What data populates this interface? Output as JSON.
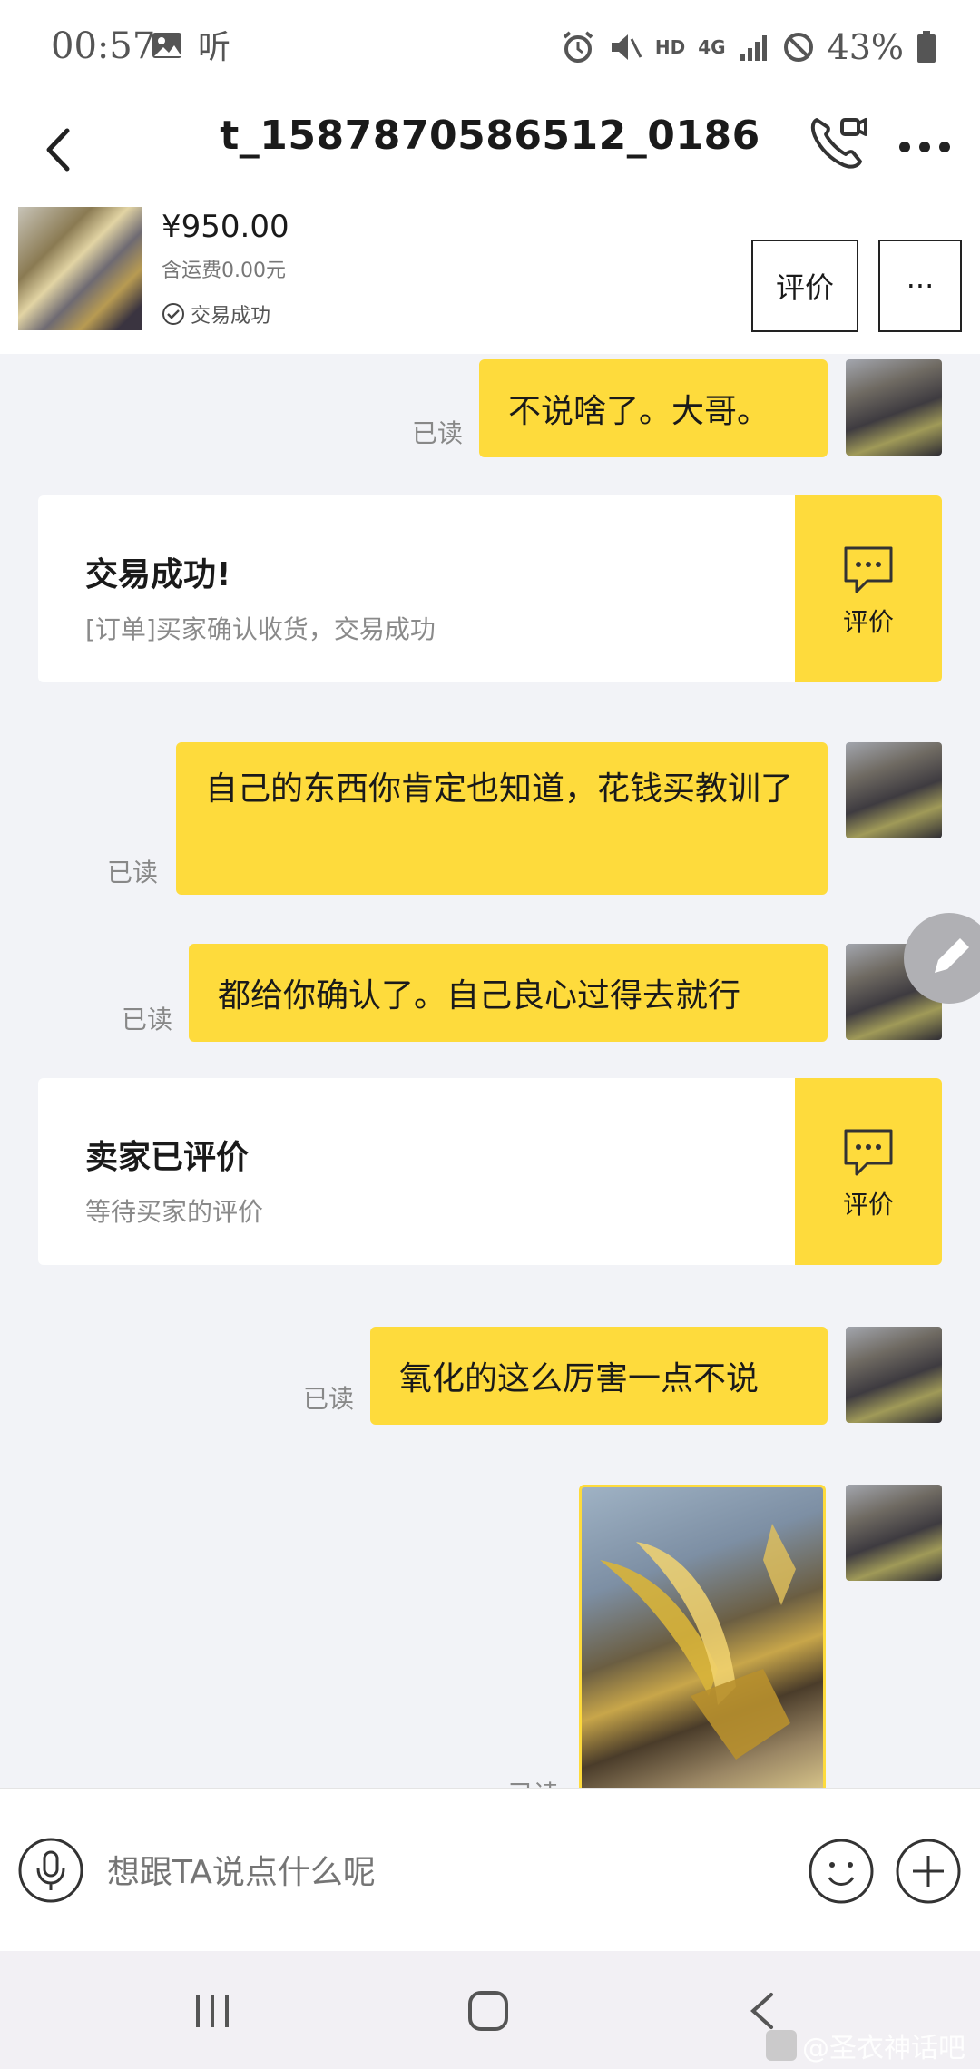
{
  "status_bar": {
    "time": "00:57",
    "hd_label": "HD",
    "network_label": "4G",
    "battery": "43%"
  },
  "header": {
    "title": "t_1587870586512_0186"
  },
  "product": {
    "price": "¥950.00",
    "shipping": "含运费0.00元",
    "status": "交易成功",
    "rate_button": "评价",
    "more_button": "···"
  },
  "messages": [
    {
      "text": "不说啥了。大哥。",
      "read": "已读"
    },
    {
      "text": "自己的东西你肯定也知道，花钱买教训了",
      "read": "已读"
    },
    {
      "text": "都给你确认了。自己良心过得去就行",
      "read": "已读"
    },
    {
      "text": "氧化的这么厉害一点不说",
      "read": "已读"
    },
    {
      "text": "",
      "read": "已读"
    }
  ],
  "cards": [
    {
      "title": "交易成功!",
      "subtitle": "[订单]买家确认收货，交易成功",
      "action": "评价"
    },
    {
      "title": "卖家已评价",
      "subtitle": "等待买家的评价",
      "action": "评价"
    }
  ],
  "input": {
    "placeholder": "想跟TA说点什么呢"
  },
  "watermark": "@圣衣神话吧",
  "colors": {
    "bubble": "#fedb3c",
    "background": "#f2f3f7"
  }
}
